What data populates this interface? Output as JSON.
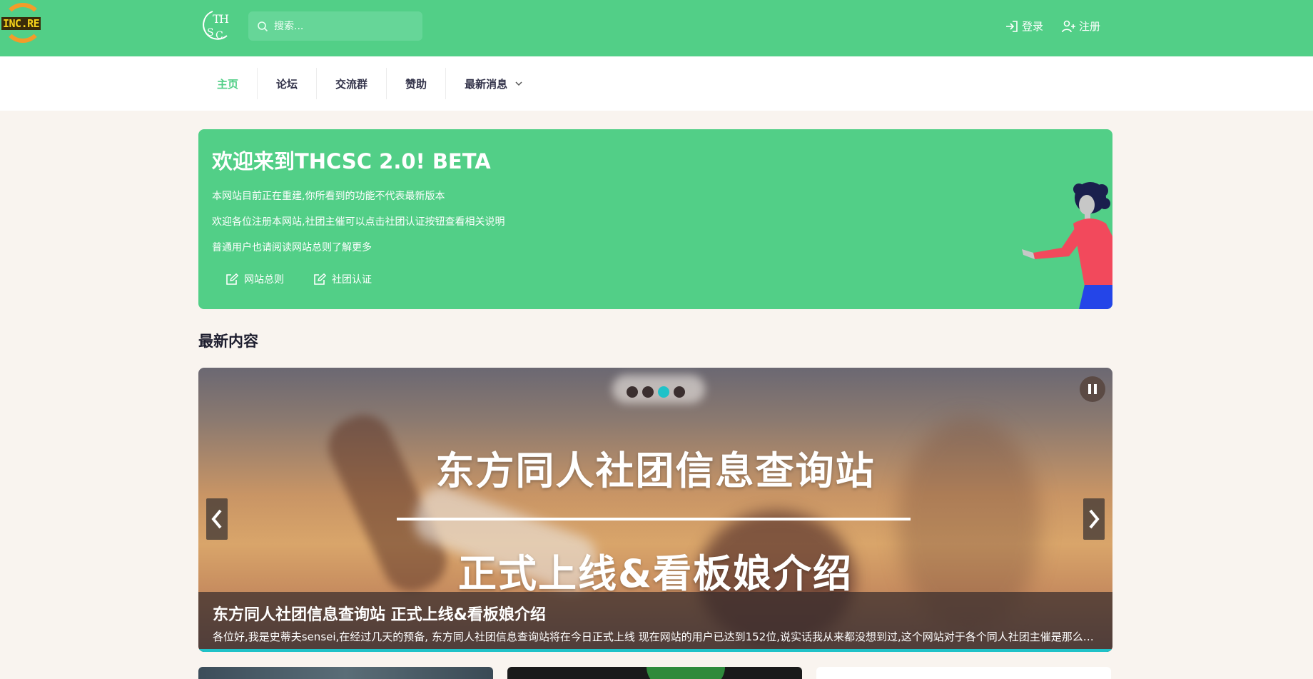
{
  "header": {
    "site_logo_text": "INC.RE",
    "brand_logo_text": "THSC",
    "search_placeholder": "搜索...",
    "login_label": "登录",
    "register_label": "注册"
  },
  "nav": {
    "items": [
      {
        "label": "主页",
        "active": true
      },
      {
        "label": "论坛"
      },
      {
        "label": "交流群"
      },
      {
        "label": "赞助"
      },
      {
        "label": "最新消息",
        "dropdown": true
      }
    ]
  },
  "welcome": {
    "title": "欢迎来到THCSC 2.0! BETA",
    "line1": "本网站目前正在重建,你所看到的功能不代表最新版本",
    "line2": "欢迎各位注册本网站,社团主催可以点击社团认证按钮查看相关说明",
    "line3": "普通用户也请阅读网站总则了解更多",
    "button1": "网站总则",
    "button2": "社团认证"
  },
  "latest": {
    "section_title": "最新内容"
  },
  "carousel": {
    "banner_line1": "东方同人社团信息查询站",
    "banner_line2": "正式上线&看板娘介绍",
    "slide_count": 4,
    "active_slide": 3,
    "caption_title": "东方同人社团信息查询站 正式上线&看板娘介绍",
    "caption_text": "各位好,我是史蒂夫sensei,在经过几天的预备, 东方同人社团信息查询站将在今日正式上线 现在网站的用户已达到152位,说实话我从来都没想到过,这个网站对于各个同人社团主催是那么的..."
  },
  "colors": {
    "brand_green": "#52cf87",
    "page_bg": "#f9f4ef",
    "accent_cyan": "#1fc2c8"
  }
}
